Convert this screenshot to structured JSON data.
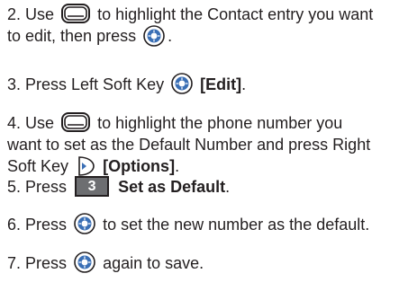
{
  "steps": {
    "s2": {
      "a": "2. Use",
      "b": "to highlight the Contact entry you want",
      "c": "to edit, then press",
      "d": "."
    },
    "s3": {
      "a": "3. Press Left Soft Key",
      "b": "[Edit]",
      "c": "."
    },
    "s4": {
      "a": "4. Use",
      "b": "to highlight the phone number you",
      "c": "want to set as the Default Number and press Right",
      "d": "Soft Key",
      "e": "[Options]",
      "f": "."
    },
    "s5": {
      "a": "5. Press",
      "key": "3",
      "b": "Set as Default",
      "c": "."
    },
    "s6": {
      "a": "6. Press",
      "b": "to set the new number as the default."
    },
    "s7": {
      "a": "7. Press",
      "b": "again to save."
    }
  },
  "icons": [
    "navigation-key-icon",
    "ok-key-icon",
    "right-soft-key-icon",
    "number-3-key-icon"
  ],
  "colors": {
    "text": "#231f20",
    "key_fill": "#6d6e71",
    "ok_blue": "#3a6fb5"
  }
}
